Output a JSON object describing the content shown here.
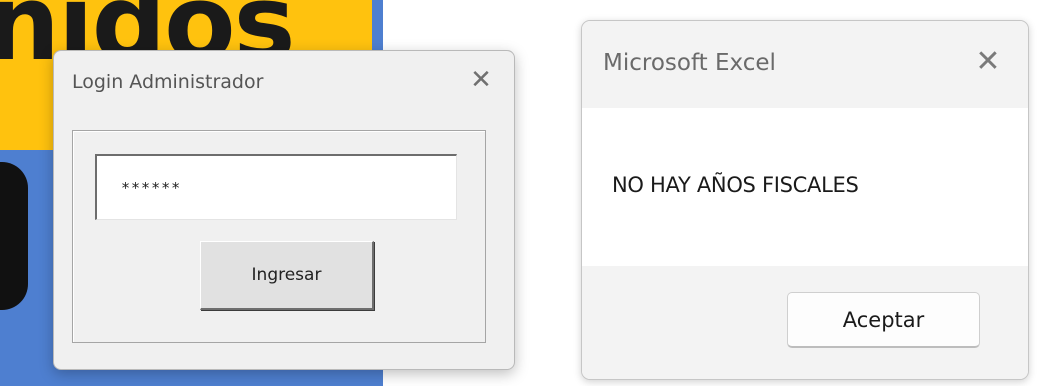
{
  "background_app": {
    "title_fragment": "nidos",
    "colors": {
      "yellow": "#ffc20e",
      "blue": "#4e7fd0",
      "dark_shape": "#111111"
    }
  },
  "login_dialog": {
    "title": "Login Administrador",
    "close_icon": "close-icon",
    "password_value": "******",
    "submit_label": "Ingresar"
  },
  "excel_dialog": {
    "title": "Microsoft Excel",
    "close_icon": "close-icon",
    "message": "NO HAY AÑOS FISCALES",
    "ok_label": "Aceptar"
  }
}
